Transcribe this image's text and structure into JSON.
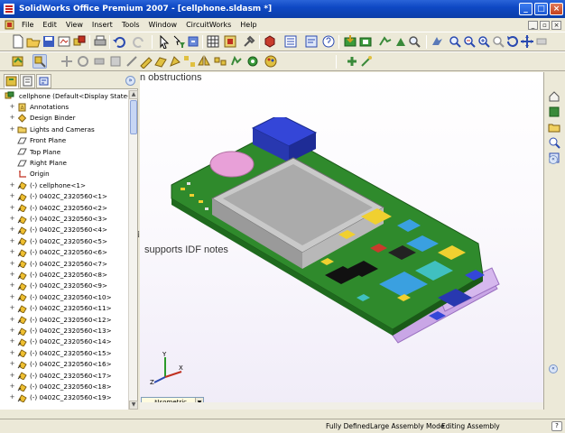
{
  "window": {
    "title": "SolidWorks Office Premium 2007 - [cellphone.sldasm *]",
    "controls": [
      "minimize",
      "maximize",
      "close"
    ]
  },
  "menubar": {
    "items": [
      "File",
      "Edit",
      "View",
      "Insert",
      "Tools",
      "Window",
      "CircuitWorks",
      "Help"
    ]
  },
  "feature_tree": {
    "root": "cellphone  (Default<Display State-1",
    "items": [
      "Annotations",
      "Design Binder",
      "Lights and Cameras",
      "Front Plane",
      "Top Plane",
      "Right Plane",
      "Origin",
      "(-) cellphone<1>",
      "(-) 0402C_2320560<1>",
      "(-) 0402C_2320560<2>",
      "(-) 0402C_2320560<3>",
      "(-) 0402C_2320560<4>",
      "(-) 0402C_2320560<5>",
      "(-) 0402C_2320560<6>",
      "(-) 0402C_2320560<7>",
      "(-) 0402C_2320560<8>",
      "(-) 0402C_2320560<9>",
      "(-) 0402C_2320560<10>",
      "(-) 0402C_2320560<11>",
      "(-) 0402C_2320560<12>",
      "(-) 0402C_2320560<13>",
      "(-) 0402C_2320560<14>",
      "(-) 0402C_2320560<15>",
      "(-) 0402C_2320560<16>",
      "(-) 0402C_2320560<17>",
      "(-) 0402C_2320560<18>",
      "(-) 0402C_2320560<19>"
    ]
  },
  "viewport": {
    "caption_top": "n obstructions",
    "caption_mid": "supports IDF notes",
    "view_orientation": "*Isometric",
    "triad_labels": {
      "x": "X",
      "y": "Y",
      "z": "Z"
    }
  },
  "statusbar": {
    "state": "Fully Defined",
    "mode": "Large Assembly Mode",
    "context": "Editing Assembly",
    "help": "?"
  },
  "colors": {
    "title_blue": "#0b3ea8",
    "pcb_green": "#2f8a2c",
    "lcd_gray": "#c9c9c9",
    "housing_purple": "#c9a6e6",
    "connector_blue": "#3446d8"
  }
}
